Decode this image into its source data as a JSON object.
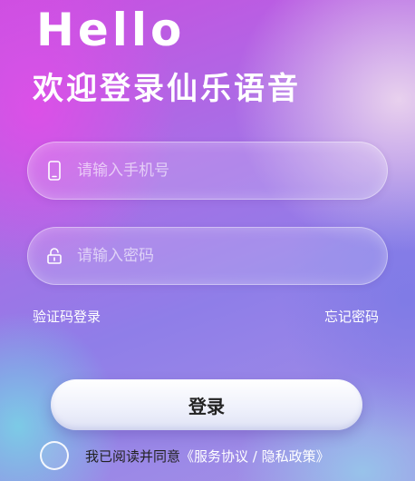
{
  "header": {
    "greeting": "Hello",
    "welcome": "欢迎登录仙乐语音"
  },
  "form": {
    "phone": {
      "icon": "phone-icon",
      "placeholder": "请输入手机号",
      "value": ""
    },
    "password": {
      "icon": "lock-icon",
      "placeholder": "请输入密码",
      "value": ""
    },
    "sms_login_label": "验证码登录",
    "forgot_password_label": "忘记密码",
    "login_label": "登录"
  },
  "agreement": {
    "checked": false,
    "text": "我已阅读并同意",
    "policy_link": "《服务协议 / 隐私政策》"
  },
  "colors": {
    "primary_gradient_start": "#c94fe0",
    "primary_gradient_end": "#8f7ee8",
    "button_bg": "#ffffff",
    "button_text": "#222222"
  }
}
